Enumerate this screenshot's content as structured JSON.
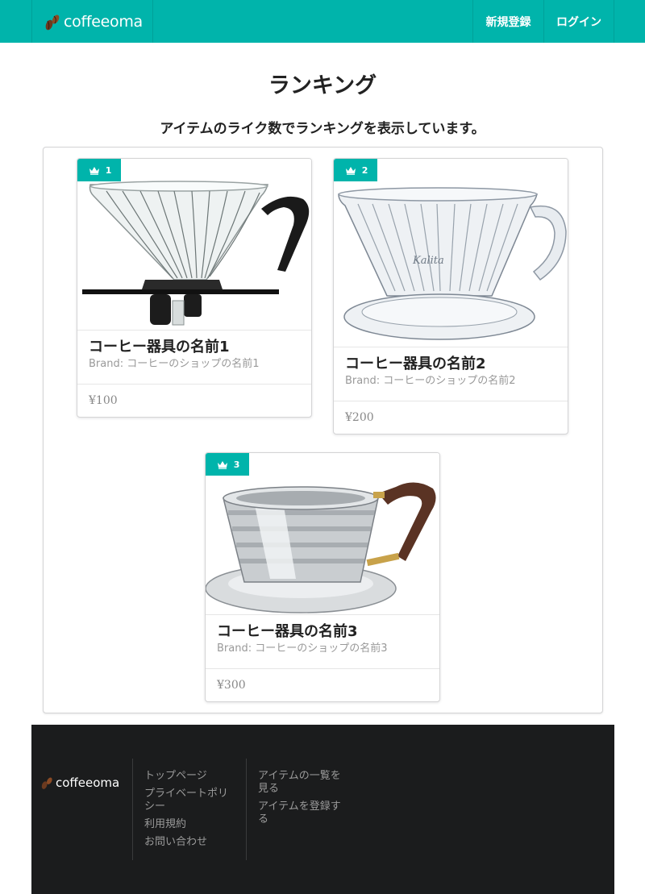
{
  "header": {
    "logo_text": "coffeeoma",
    "nav": {
      "signup": "新規登録",
      "login": "ログイン"
    }
  },
  "page": {
    "title": "ランキング",
    "subtitle": "アイテムのライク数でランキングを表示しています。"
  },
  "items": [
    {
      "rank": "1",
      "name": "コーヒー器具の名前1",
      "brand": "Brand: コーヒーのショップの名前1",
      "price": "¥100"
    },
    {
      "rank": "2",
      "name": "コーヒー器具の名前2",
      "brand": "Brand: コーヒーのショップの名前2",
      "price": "¥200"
    },
    {
      "rank": "3",
      "name": "コーヒー器具の名前3",
      "brand": "Brand: コーヒーのショップの名前3",
      "price": "¥300"
    }
  ],
  "footer": {
    "logo_text": "coffeeoma",
    "links_col1": [
      "トップページ",
      "プライベートポリシー",
      "利用規約",
      "お問い合わせ"
    ],
    "links_col2": [
      "アイテムの一覧を見る",
      "アイテムを登録する"
    ]
  },
  "colors": {
    "accent": "#00b4ab",
    "footer_bg": "#1b1c1d",
    "ribbon_icon": "crown-icon"
  }
}
